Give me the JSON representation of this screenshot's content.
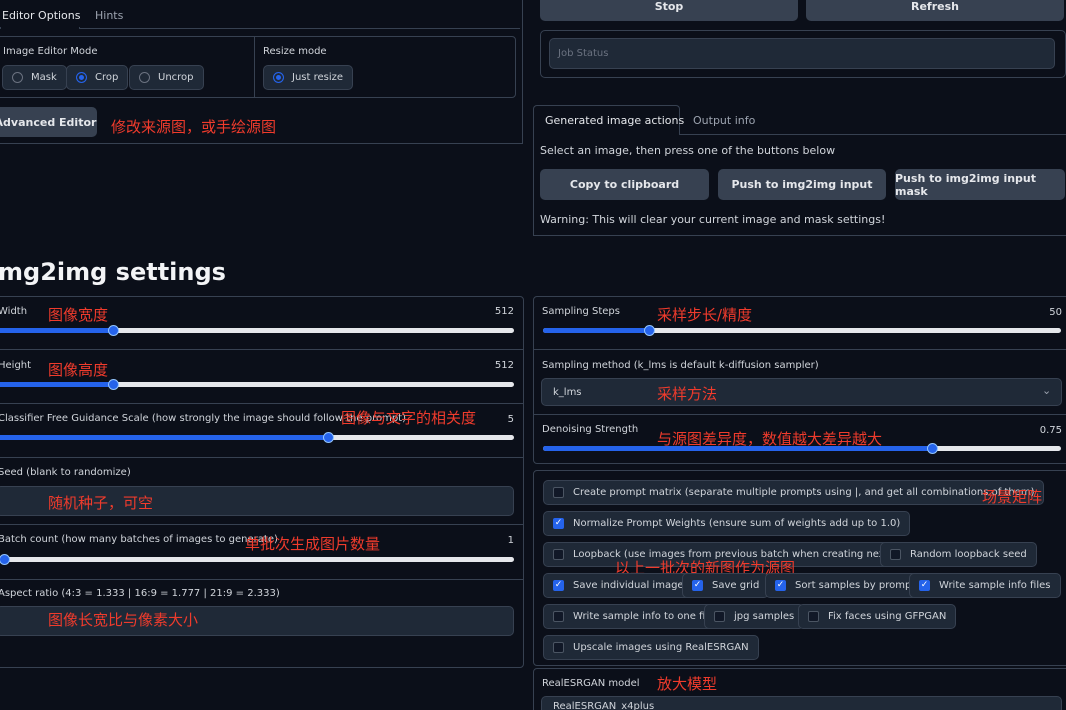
{
  "editor_tabs": {
    "tab1": "Editor Options",
    "tab2": "Hints"
  },
  "editor_options": {
    "mode_label": "Image Editor Mode",
    "mode_options": [
      "Mask",
      "Crop",
      "Uncrop"
    ],
    "mode_selected": "Crop",
    "resize_label": "Resize mode",
    "resize_option": "Just resize",
    "advanced_button": "Advanced Editor",
    "advanced_note": "修改来源图，或手绘源图"
  },
  "top_buttons": {
    "stop": "Stop",
    "refresh": "Refresh"
  },
  "job_status": {
    "placeholder": "Job Status"
  },
  "actions": {
    "tab1": "Generated image actions",
    "tab2": "Output info",
    "instruction": "Select an image, then press one of the buttons below",
    "buttons": [
      "Copy to clipboard",
      "Push to img2img input",
      "Push to img2img input mask"
    ],
    "warning": "Warning: This will clear your current image and mask settings!"
  },
  "section_title": "mg2img settings",
  "left_settings": {
    "width": {
      "label": "Width",
      "value": "512",
      "fraction": 0.225,
      "note": "图像宽度"
    },
    "height": {
      "label": "Height",
      "value": "512",
      "fraction": 0.225,
      "note": "图像高度"
    },
    "cfg": {
      "label": "Classifier Free Guidance Scale (how strongly the image should follow the prompt)",
      "value": "5",
      "fraction": 0.64,
      "note": "图像与文字的相关度"
    },
    "seed": {
      "label": "Seed (blank to randomize)",
      "note": "随机种子，可空"
    },
    "batch": {
      "label": "Batch count (how many batches of images to generate)",
      "value": "1",
      "fraction": 0.0,
      "note": "单批次生成图片数量"
    },
    "aspect": {
      "label": "Aspect ratio (4:3 = 1.333 | 16:9 = 1.777 | 21:9 = 2.333)",
      "note": "图像长宽比与像素大小"
    }
  },
  "right_settings": {
    "steps": {
      "label": "Sampling Steps",
      "value": "50",
      "fraction": 0.205,
      "note": "采样步长/精度"
    },
    "method": {
      "label": "Sampling method (k_lms is default k-diffusion sampler)",
      "value": "k_lms",
      "note": "采样方法"
    },
    "denoise": {
      "label": "Denoising Strength",
      "value": "0.75",
      "fraction": 0.75,
      "note": "与源图差异度，数值越大差异越大"
    }
  },
  "checkboxes": {
    "prompt_matrix": "Create prompt matrix (separate multiple prompts using |, and get all combinations of them)",
    "prompt_matrix_note": "场景矩阵",
    "normalize": "Normalize Prompt Weights (ensure sum of weights add up to 1.0)",
    "loopback": "Loopback (use images from previous batch when creating next batch)",
    "loopback_seed": "Random loopback seed",
    "loopback_note": "以上一批次的新图作为源图",
    "save_individual": "Save individual images",
    "save_grid": "Save grid",
    "sort_samples": "Sort samples by prompt",
    "write_info": "Write sample info files",
    "write_one": "Write sample info to one file",
    "jpg": "jpg samples",
    "gfpgan": "Fix faces using GFPGAN",
    "esrgan": "Upscale images using RealESRGAN"
  },
  "esrgan_model": {
    "label": "RealESRGAN model",
    "note": "放大模型",
    "value": "RealESRGAN_x4plus"
  },
  "colors": {
    "accent": "#2563eb",
    "note_red": "#ef3b2c",
    "background": "#0b0f19",
    "panel": "#1f2937"
  }
}
